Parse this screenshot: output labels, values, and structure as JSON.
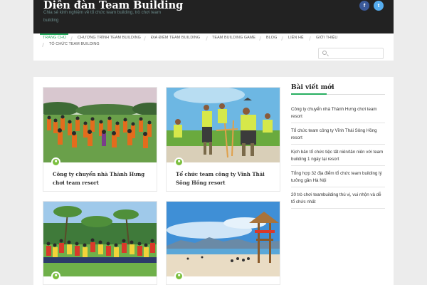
{
  "site": {
    "title": "Diễn đàn Team Building",
    "tagline": "Chia sẻ kinh nghiệm về tổ chức team building, trò chơi team building"
  },
  "social": {
    "facebook_glyph": "f",
    "twitter_glyph": "t",
    "facebook_color": "#3b5998",
    "twitter_color": "#55acee"
  },
  "nav": {
    "items": [
      {
        "label": "TRANG CHỦ",
        "active": true
      },
      {
        "label": "CHƯƠNG TRÌNH TEAM BUILDING"
      },
      {
        "label": "ĐỊA ĐIỂM TEAM BUILDING"
      },
      {
        "label": "TEAM BUILDING GAME"
      },
      {
        "label": "BLOG"
      },
      {
        "label": "LIÊN HỆ"
      },
      {
        "label": "GIỚI THIỆU"
      },
      {
        "label": "TỔ CHỨC TEAM BUILDING"
      }
    ],
    "accent_color": "#27ae60",
    "search_placeholder": ""
  },
  "posts": [
    {
      "title": "Công ty chuyển nhà Thành Hưng chơi team resort",
      "badge_icon": "document-icon"
    },
    {
      "title": "Tổ chức team công ty Vĩnh Thái Sông Hồng resort",
      "badge_icon": "document-icon"
    },
    {
      "title": "",
      "badge_icon": "document-icon"
    },
    {
      "title": "",
      "badge_icon": "document-icon"
    }
  ],
  "sidebar": {
    "title": "Bài viết mới",
    "recent_posts": [
      "Công ty chuyển nhà Thành Hưng chơi team resort",
      "Tổ chức team công ty Vĩnh Thái Sông Hồng resort",
      "Kịch bản tổ chức tiệc tất niên/tân niên với team building 1 ngày tại resort",
      "Tổng hợp 32 địa điểm tổ chức team building lý tưởng gần Hà Nội",
      "20 trò chơi teambuilding thú vị, vui nhộn và dễ tổ chức nhất"
    ]
  }
}
